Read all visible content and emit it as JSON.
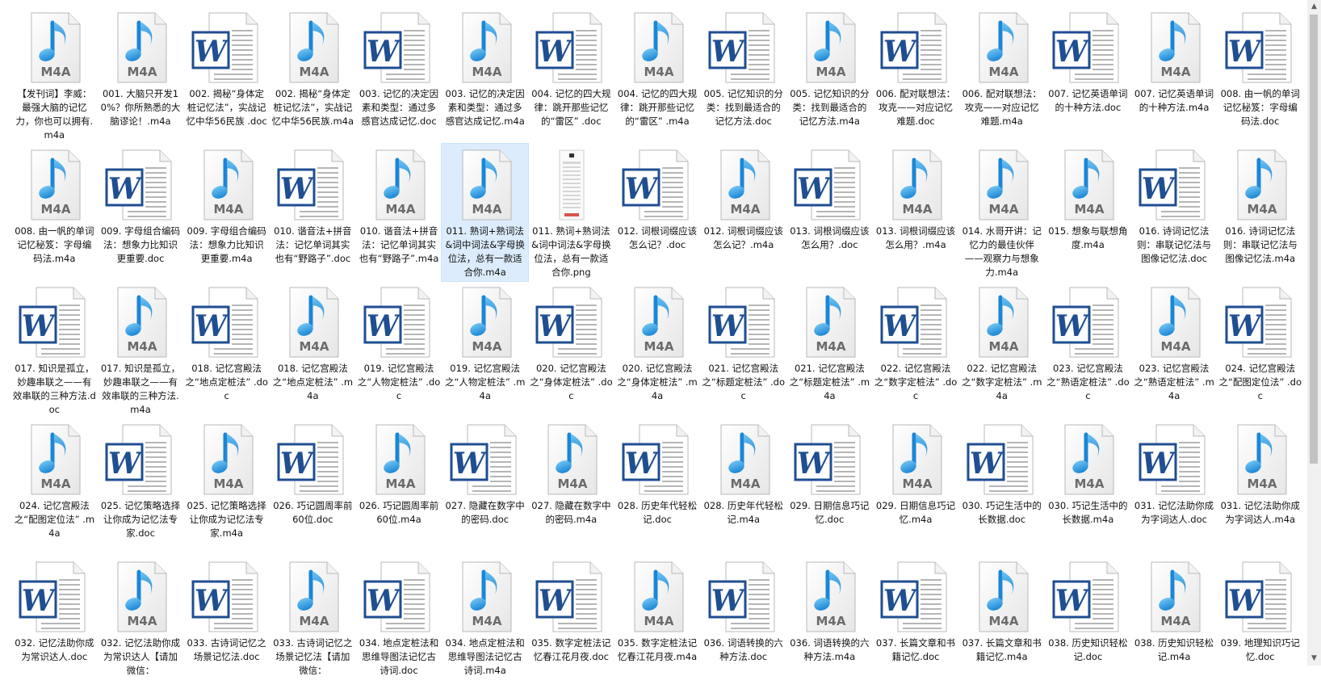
{
  "icons": {
    "audio": "music-note-icon",
    "word": "word-document-icon",
    "image": "image-thumbnail-icon"
  },
  "badges": {
    "m4a": "M4A",
    "word_letter": "W"
  },
  "files": [
    {
      "name": "【发刊词】李威：最强大脑的记忆力，你也可以拥有.m4a",
      "type": "m4a"
    },
    {
      "name": "001. 大脑只开发10%？你所熟悉的大脑谬论！.m4a",
      "type": "m4a"
    },
    {
      "name": "002. 揭秘“身体定桩记忆法”，实战记忆中华56民族 .doc",
      "type": "doc"
    },
    {
      "name": "002. 揭秘“身体定桩记忆法”，实战记忆中华56民族.m4a",
      "type": "m4a"
    },
    {
      "name": "003. 记忆的决定因素和类型：通过多感官达成记忆.doc",
      "type": "doc"
    },
    {
      "name": "003. 记忆的决定因素和类型：通过多感官达成记忆.m4a",
      "type": "m4a"
    },
    {
      "name": "004. 记忆的四大规律：跳开那些记忆的“雷区” .doc",
      "type": "doc"
    },
    {
      "name": "004. 记忆的四大规律：跳开那些记忆的“雷区” .m4a",
      "type": "m4a"
    },
    {
      "name": "005. 记忆知识的分类：找到最适合的记忆方法.doc",
      "type": "doc"
    },
    {
      "name": "005. 记忆知识的分类：找到最适合的记忆方法.m4a",
      "type": "m4a"
    },
    {
      "name": "006. 配对联想法：攻克——对应记忆难题.doc",
      "type": "doc"
    },
    {
      "name": "006. 配对联想法：攻克——对应记忆难题.m4a",
      "type": "m4a"
    },
    {
      "name": "007. 记忆英语单词的十种方法.doc",
      "type": "doc"
    },
    {
      "name": "007. 记忆英语单词的十种方法.m4a",
      "type": "m4a"
    },
    {
      "name": "008. 由一帆的单词记忆秘笈：字母编码法.doc",
      "type": "doc"
    },
    {
      "name": "008. 由一帆的单词记忆秘笈：字母编码法.m4a",
      "type": "m4a"
    },
    {
      "name": "009. 字母组合编码法：想象力比知识更重要.doc",
      "type": "doc"
    },
    {
      "name": "009. 字母组合编码法：想象力比知识更重要.m4a",
      "type": "m4a"
    },
    {
      "name": "010. 谐音法+拼音法：记忆单词其实也有“野路子”.doc",
      "type": "doc"
    },
    {
      "name": "010. 谐音法+拼音法：记忆单词其实也有“野路子”.m4a",
      "type": "m4a"
    },
    {
      "name": "011. 熟词+熟词法&词中词法&字母换位法，总有一款适合你.m4a",
      "type": "m4a",
      "selected": true
    },
    {
      "name": "011. 熟词+熟词法&词中词法&字母换位法，总有一款适合你.png",
      "type": "png"
    },
    {
      "name": "012. 词根词缀应该怎么记？.doc",
      "type": "doc"
    },
    {
      "name": "012. 词根词缀应该怎么记？.m4a",
      "type": "m4a"
    },
    {
      "name": "013. 词根词缀应该怎么用？.doc",
      "type": "doc"
    },
    {
      "name": "013. 词根词缀应该怎么用？.m4a",
      "type": "m4a"
    },
    {
      "name": "014. 水哥开讲：记忆力的最佳伙伴——观察力与想象力.m4a",
      "type": "m4a"
    },
    {
      "name": "015. 想象与联想角度.m4a",
      "type": "m4a"
    },
    {
      "name": "016. 诗词记忆法则：串联记忆法与图像记忆法.doc",
      "type": "doc"
    },
    {
      "name": "016. 诗词记忆法则：串联记忆法与图像记忆法.m4a",
      "type": "m4a"
    },
    {
      "name": "017. 知识是孤立，妙趣串联之——有效串联的三种方法.doc",
      "type": "doc"
    },
    {
      "name": "017. 知识是孤立，妙趣串联之——有效串联的三种方法.m4a",
      "type": "m4a"
    },
    {
      "name": "018. 记忆宫殿法之“地点定桩法” .doc",
      "type": "doc"
    },
    {
      "name": "018. 记忆宫殿法之“地点定桩法” .m4a",
      "type": "m4a"
    },
    {
      "name": "019. 记忆宫殿法之“人物定桩法” .doc",
      "type": "doc"
    },
    {
      "name": "019. 记忆宫殿法之“人物定桩法” .m4a",
      "type": "m4a"
    },
    {
      "name": "020. 记忆宫殿法之“身体定桩法” .doc",
      "type": "doc"
    },
    {
      "name": "020. 记忆宫殿法之“身体定桩法” .m4a",
      "type": "m4a"
    },
    {
      "name": "021. 记忆宫殿法之“标题定桩法” .doc",
      "type": "doc"
    },
    {
      "name": "021. 记忆宫殿法之“标题定桩法” .m4a",
      "type": "m4a"
    },
    {
      "name": "022. 记忆宫殿法之“数字定桩法” .doc",
      "type": "doc"
    },
    {
      "name": "022. 记忆宫殿法之“数字定桩法” .m4a",
      "type": "m4a"
    },
    {
      "name": "023. 记忆宫殿法之“熟语定桩法” .doc",
      "type": "doc"
    },
    {
      "name": "023. 记忆宫殿法之“熟语定桩法” .m4a",
      "type": "m4a"
    },
    {
      "name": "024. 记忆宫殿法之“配图定位法” .doc",
      "type": "doc"
    },
    {
      "name": "024. 记忆宫殿法之“配图定位法” .m4a",
      "type": "m4a"
    },
    {
      "name": "025. 记忆策略选择让你成为记忆法专家.doc",
      "type": "doc"
    },
    {
      "name": "025. 记忆策略选择让你成为记忆法专家.m4a",
      "type": "m4a"
    },
    {
      "name": "026. 巧记圆周率前60位.doc",
      "type": "doc"
    },
    {
      "name": "026. 巧记圆周率前60位.m4a",
      "type": "m4a"
    },
    {
      "name": "027. 隐藏在数字中的密码.doc",
      "type": "doc"
    },
    {
      "name": "027. 隐藏在数字中的密码.m4a",
      "type": "m4a"
    },
    {
      "name": "028. 历史年代轻松记.doc",
      "type": "doc"
    },
    {
      "name": "028. 历史年代轻松记.m4a",
      "type": "m4a"
    },
    {
      "name": "029. 日期信息巧记忆.doc",
      "type": "doc"
    },
    {
      "name": "029. 日期信息巧记忆.m4a",
      "type": "m4a"
    },
    {
      "name": "030. 巧记生活中的长数据.doc",
      "type": "doc"
    },
    {
      "name": "030. 巧记生活中的长数据.m4a",
      "type": "m4a"
    },
    {
      "name": "031. 记忆法助你成为字词达人.doc",
      "type": "doc"
    },
    {
      "name": "031. 记忆法助你成为字词达人.m4a",
      "type": "m4a"
    },
    {
      "name": "032. 记忆法助你成为常识达人.doc",
      "type": "doc"
    },
    {
      "name": "032. 记忆法助你成为常识达人【请加微信：",
      "type": "m4a"
    },
    {
      "name": "033. 古诗词记忆之场景记忆法.doc",
      "type": "doc"
    },
    {
      "name": "033. 古诗词记忆之场景记忆法【请加微信：",
      "type": "m4a"
    },
    {
      "name": "034. 地点定桩法和思维导图法记忆古诗词.doc",
      "type": "doc"
    },
    {
      "name": "034. 地点定桩法和思维导图法记忆古诗词.m4a",
      "type": "m4a"
    },
    {
      "name": "035. 数字定桩法记忆春江花月夜.doc",
      "type": "doc"
    },
    {
      "name": "035. 数字定桩法记忆春江花月夜.m4a",
      "type": "m4a"
    },
    {
      "name": "036. 词语转换的六种方法.doc",
      "type": "doc"
    },
    {
      "name": "036. 词语转换的六种方法.m4a",
      "type": "m4a"
    },
    {
      "name": "037. 长篇文章和书籍记忆.doc",
      "type": "doc"
    },
    {
      "name": "037. 长篇文章和书籍记忆.m4a",
      "type": "m4a"
    },
    {
      "name": "038. 历史知识轻松记.doc",
      "type": "doc"
    },
    {
      "name": "038. 历史知识轻松记.m4a",
      "type": "m4a"
    },
    {
      "name": "039. 地理知识巧记忆.doc",
      "type": "doc"
    }
  ]
}
